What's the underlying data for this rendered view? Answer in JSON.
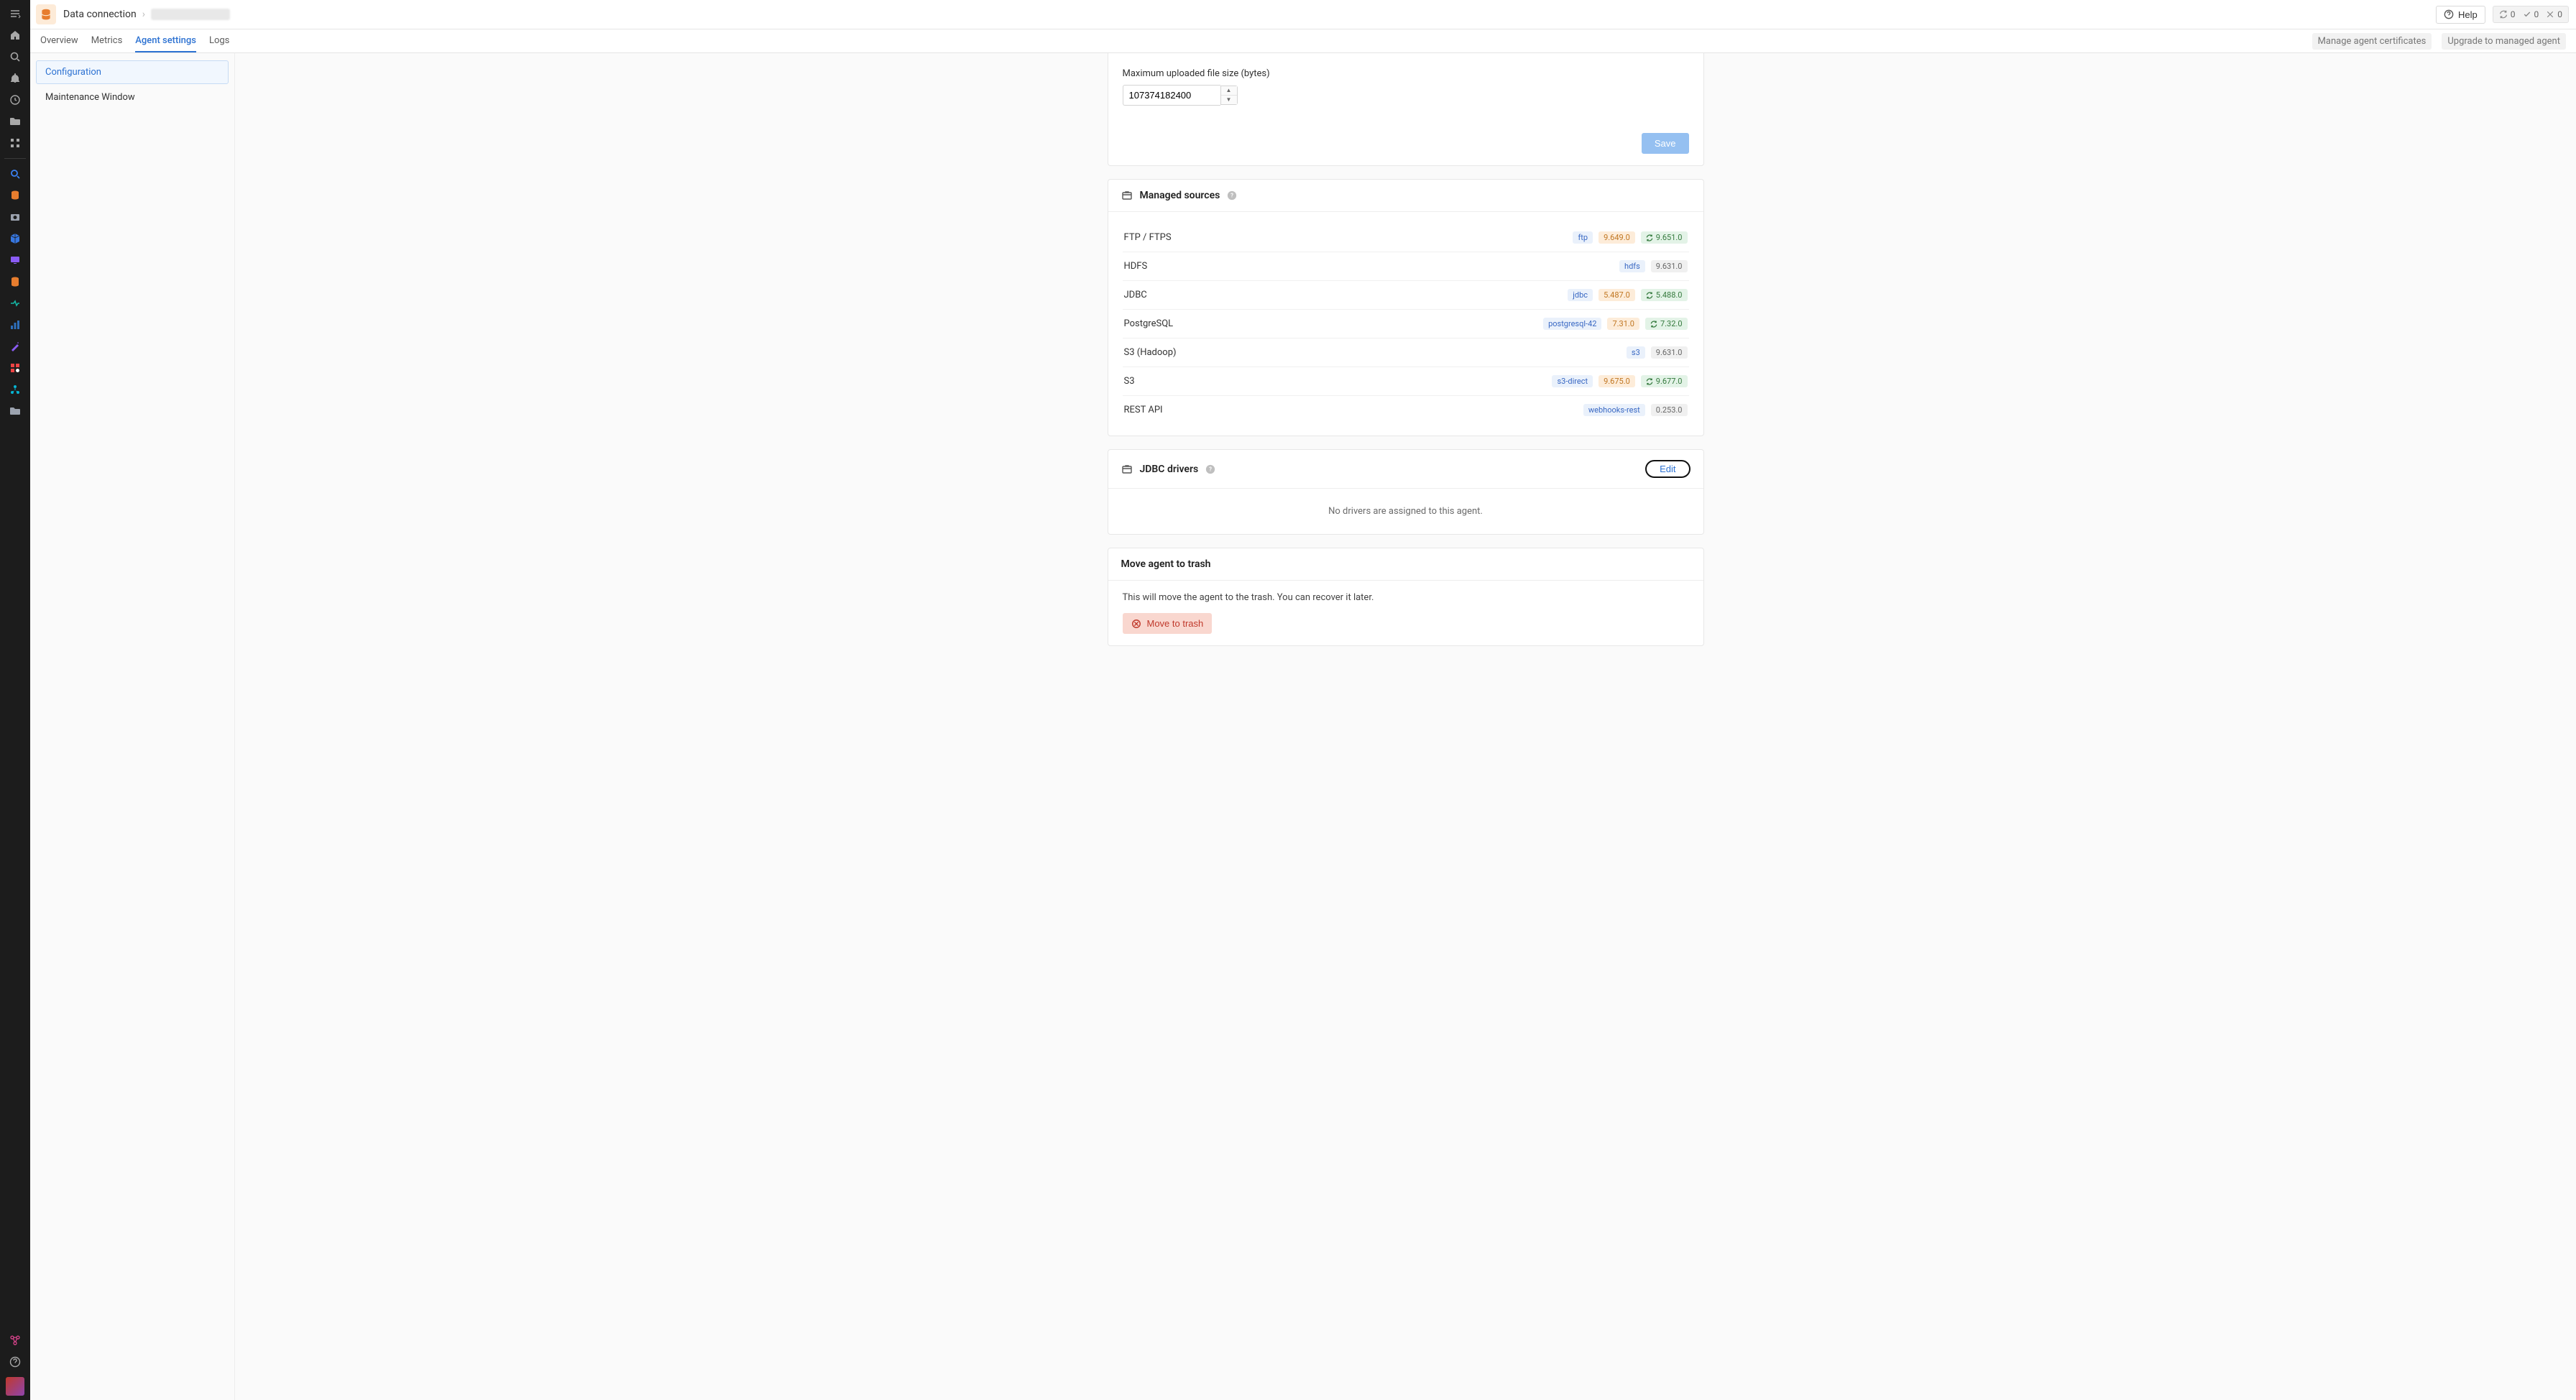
{
  "header": {
    "breadcrumb_root": "Data connection",
    "help_label": "Help",
    "status": {
      "sync": "0",
      "check": "0",
      "close": "0"
    }
  },
  "tabs": {
    "items": [
      "Overview",
      "Metrics",
      "Agent settings",
      "Logs"
    ],
    "active": "Agent settings",
    "right": {
      "manage_certs": "Manage agent certificates",
      "upgrade": "Upgrade to managed agent"
    }
  },
  "sidemenu": {
    "items": [
      {
        "label": "Configuration",
        "active": true
      },
      {
        "label": "Maintenance Window",
        "active": false
      }
    ]
  },
  "upload": {
    "label": "Maximum uploaded file size (bytes)",
    "value": "107374182400",
    "save_label": "Save"
  },
  "managed_sources": {
    "title": "Managed sources",
    "rows": [
      {
        "name": "FTP / FTPS",
        "proto": "ftp",
        "current": "9.649.0",
        "available": "9.651.0",
        "has_update": true
      },
      {
        "name": "HDFS",
        "proto": "hdfs",
        "current": "9.631.0",
        "available": null,
        "has_update": false
      },
      {
        "name": "JDBC",
        "proto": "jdbc",
        "current": "5.487.0",
        "available": "5.488.0",
        "has_update": true
      },
      {
        "name": "PostgreSQL",
        "proto": "postgresql-42",
        "current": "7.31.0",
        "available": "7.32.0",
        "has_update": true
      },
      {
        "name": "S3 (Hadoop)",
        "proto": "s3",
        "current": "9.631.0",
        "available": null,
        "has_update": false
      },
      {
        "name": "S3",
        "proto": "s3-direct",
        "current": "9.675.0",
        "available": "9.677.0",
        "has_update": true
      },
      {
        "name": "REST API",
        "proto": "webhooks-rest",
        "current": "0.253.0",
        "available": null,
        "has_update": false
      }
    ]
  },
  "jdbc_drivers": {
    "title": "JDBC drivers",
    "edit_label": "Edit",
    "empty_text": "No drivers are assigned to this agent."
  },
  "trash": {
    "title": "Move agent to trash",
    "desc": "This will move the agent to the trash. You can recover it later.",
    "button_label": "Move to trash"
  }
}
